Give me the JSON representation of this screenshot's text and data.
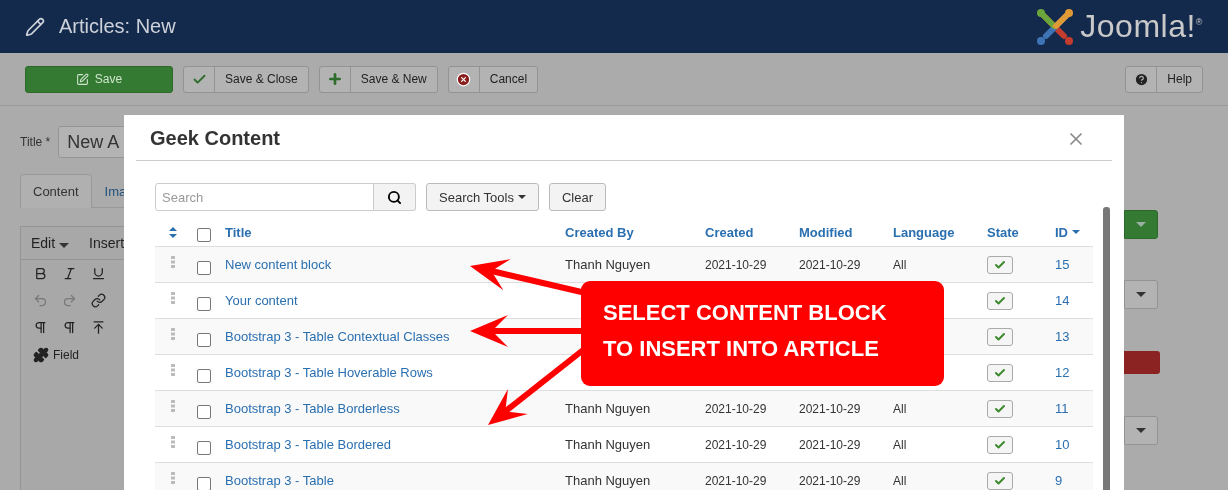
{
  "header": {
    "title": "Articles: New",
    "logo_text": "Joomla!$^{®}$"
  },
  "toolbar": {
    "buttons": [
      {
        "label": "Save",
        "kind": "primary"
      },
      {
        "label": "Save & Close",
        "kind": "check"
      },
      {
        "label": "Save & New",
        "kind": "plus"
      },
      {
        "label": "Cancel",
        "kind": "cancel"
      }
    ],
    "help": "Help"
  },
  "form": {
    "title_label": "Title *",
    "title_value": "New A",
    "tabs": [
      {
        "label": "Content",
        "selected": true
      },
      {
        "label": "Ima",
        "selected": false
      }
    ],
    "editor_menu": [
      "Edit",
      "Insert"
    ],
    "field_button": "Field"
  },
  "modal": {
    "title": "Geek Content",
    "search": {
      "placeholder": "Search"
    },
    "search_tools": "Search Tools",
    "clear": "Clear",
    "select_all_checked": false,
    "columns": [
      {
        "label": "Title",
        "sorted": false
      },
      {
        "label": "Created By",
        "sorted": false
      },
      {
        "label": "Created",
        "sorted": false
      },
      {
        "label": "Modified",
        "sorted": false
      },
      {
        "label": "Language",
        "sorted": false
      },
      {
        "label": "State",
        "sorted": false
      },
      {
        "label": "ID",
        "sorted": true
      }
    ],
    "rows": [
      {
        "title": "New content block",
        "created_by": "Thanh Nguyen",
        "created": "2021-10-29",
        "modified": "2021-10-29",
        "language": "All",
        "published": true,
        "id": "15",
        "checked": false
      },
      {
        "title": "Your content",
        "published": true,
        "id": "14",
        "checked": false
      },
      {
        "title": "Bootstrap 3 - Table Contextual Classes",
        "published": true,
        "id": "13",
        "checked": false
      },
      {
        "title": "Bootstrap 3 - Table Hoverable Rows",
        "published": true,
        "id": "12",
        "checked": false
      },
      {
        "title": "Bootstrap 3 - Table Borderless",
        "created_by": "Thanh Nguyen",
        "created": "2021-10-29",
        "modified": "2021-10-29",
        "language": "All",
        "published": true,
        "id": "11",
        "checked": false
      },
      {
        "title": "Bootstrap 3 - Table Bordered",
        "created_by": "Thanh Nguyen",
        "created": "2021-10-29",
        "modified": "2021-10-29",
        "language": "All",
        "published": true,
        "id": "10",
        "checked": false
      },
      {
        "title": "Bootstrap 3 - Table",
        "created_by": "Thanh Nguyen",
        "created": "2021-10-29",
        "modified": "2021-10-29",
        "language": "All",
        "published": true,
        "id": "9",
        "checked": false
      }
    ]
  },
  "callout": {
    "text": "SELECT CONTENT BLOCK TO INSERT INTO ARTICLE"
  }
}
